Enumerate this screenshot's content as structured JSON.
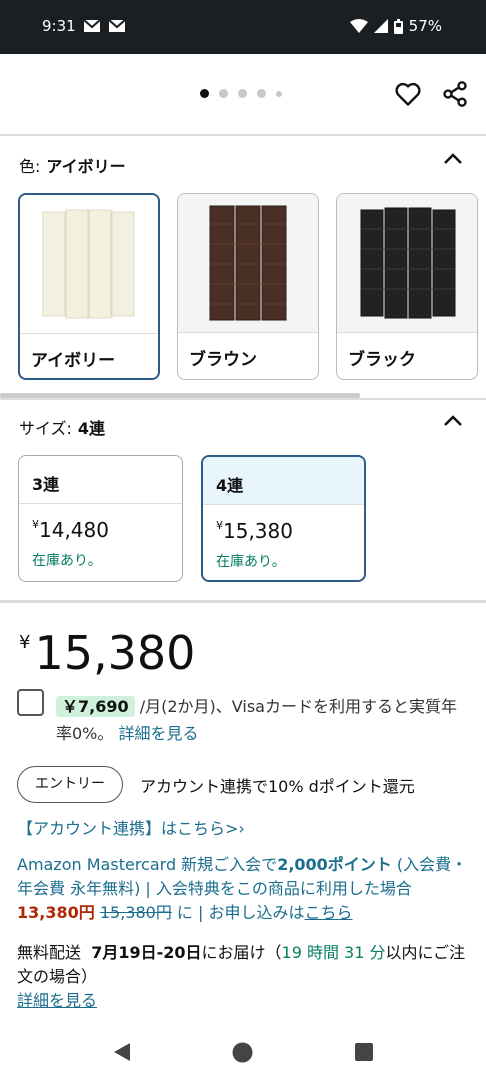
{
  "status_bar": {
    "time": "9:31",
    "battery": "57%"
  },
  "color_section": {
    "label": "色:",
    "selected": "アイボリー",
    "options": [
      {
        "label": "アイボリー",
        "selected": true
      },
      {
        "label": "ブラウン",
        "selected": false
      },
      {
        "label": "ブラック",
        "selected": false
      }
    ]
  },
  "size_section": {
    "label": "サイズ:",
    "selected": "4連",
    "options": [
      {
        "label": "3連",
        "currency": "¥",
        "price": "14,480",
        "stock": "在庫あり。",
        "selected": false
      },
      {
        "label": "4連",
        "currency": "¥",
        "price": "15,380",
        "stock": "在庫あり。",
        "selected": true
      }
    ]
  },
  "price": {
    "currency": "¥",
    "value": "15,380"
  },
  "visa": {
    "badge": "￥7,690",
    "text": "/月(2か月)、Visaカードを利用すると実質年率0%。",
    "link": "詳細を見る"
  },
  "entry": {
    "button": "エントリー",
    "text": "アカウント連携で10% dポイント還元",
    "link": "【アカウント連携】はこちら>›"
  },
  "mastercard": {
    "prefix": "Amazon Mastercard 新規ご入会で",
    "points": "2,000ポイント",
    "middle": " (入会費・年会費 永年無料) | 入会特典をこの商品に利用した場合",
    "new_price": "13,380円",
    "old_price": "15,380円",
    "suffix": " に | お申し込みは",
    "link": "こちら"
  },
  "delivery": {
    "prefix": "無料配送",
    "dates": "7月19日-20日",
    "mid": "にお届け（",
    "countdown": "19 時間 31 分",
    "suffix": "以内にご注文の場合）",
    "link": "詳細を見る"
  }
}
